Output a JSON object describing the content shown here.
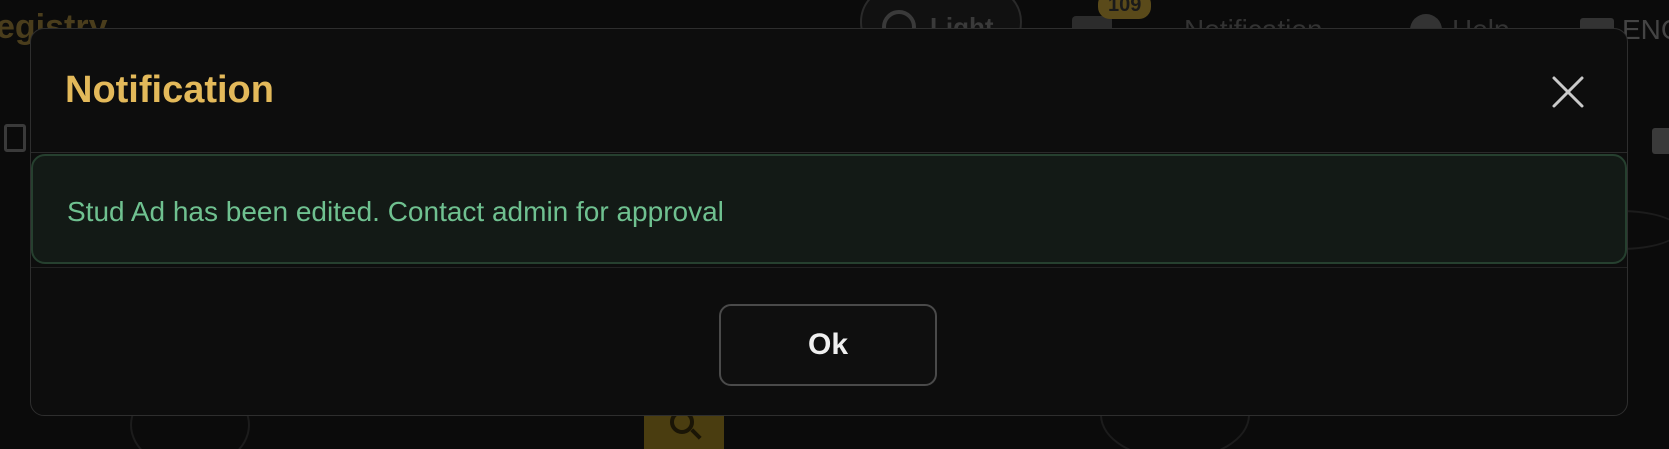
{
  "background": {
    "brand_text": "egistry",
    "theme_toggle_label": "Light",
    "inbox_count": "109",
    "notification_label": "Notification",
    "help_label": "Help",
    "language_label": "ENG"
  },
  "modal": {
    "title": "Notification",
    "message": "Stud Ad has been edited. Contact admin for approval",
    "ok_label": "Ok",
    "close_icon": "close-icon"
  },
  "colors": {
    "title": "#e3b95a",
    "alert_text": "#6fc190",
    "alert_bg": "#131a16",
    "modal_bg": "#0d0d0d"
  }
}
